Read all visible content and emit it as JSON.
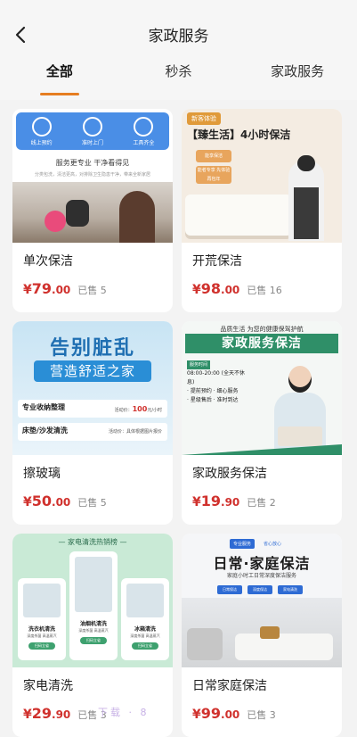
{
  "header": {
    "title": "家政服务"
  },
  "tabs": [
    {
      "label": "全部",
      "active": true
    },
    {
      "label": "秒杀",
      "active": false
    },
    {
      "label": "家政服务",
      "active": false
    }
  ],
  "colors": {
    "accent": "#e67e22",
    "price": "#d0312d"
  },
  "products": [
    {
      "title": "单次保洁",
      "price_cur": "¥",
      "price_int": "79",
      "price_dec": ".00",
      "sold": "已售 5",
      "image": {
        "icons": [
          "线上预约",
          "准时上门",
          "工具齐全"
        ],
        "slogan": "服务更专业 干净看得见",
        "small": "分类包洗，清洁更高，对排除卫生隐患干净，带来全新家居"
      }
    },
    {
      "title": "开荒保洁",
      "price_cur": "¥",
      "price_int": "98",
      "price_dec": ".00",
      "sold": "已售 16",
      "image": {
        "badge": "新客体验",
        "headline": "【臻生活】4小时保洁",
        "chip1": "能享保洁",
        "chip2": "能者专享 先体验再包年"
      }
    },
    {
      "title": "擦玻璃",
      "price_cur": "¥",
      "price_int": "50",
      "price_dec": ".00",
      "sold": "已售 5",
      "image": {
        "line1": "告别脏乱",
        "line2": "营造舒适之家",
        "row1_label": "专业收纳整理",
        "row1_note": "2小时起服务",
        "row1_price_prefix": "活动价：",
        "row1_price": "100",
        "row1_unit": "元/小时",
        "row2_label": "床垫/沙发清洗",
        "row2_note": "活动价：具体根据图片报价"
      }
    },
    {
      "title": "家政服务保洁",
      "price_cur": "¥",
      "price_int": "19",
      "price_dec": ".90",
      "sold": "已售 2",
      "image": {
        "top": "品质生活 为您的健康保驾护航",
        "banner": "家政服务保洁",
        "tag": "服务时间",
        "hours": "08:00-20:00 (全天不休息)",
        "points": [
          "· 提前预约 · 细心服务",
          "· 星级售后 · 准时到达"
        ]
      }
    },
    {
      "title": "家电清洗",
      "price_cur": "¥",
      "price_int": "29",
      "price_dec": ".90",
      "sold": "已售 3",
      "image": {
        "head": "— 家电清洗热销榜 —",
        "cells": [
          {
            "label": "洗衣机清洗",
            "sub": "深度杀菌 高温蒸汽",
            "btn": "扫码立省"
          },
          {
            "label": "油烟机清洗",
            "sub": "深度杀菌 高温蒸汽",
            "btn": "扫码立省"
          },
          {
            "label": "冰箱清洗",
            "sub": "深度杀菌 高温蒸汽",
            "btn": "扫码立省"
          }
        ]
      }
    },
    {
      "title": "日常家庭保洁",
      "price_cur": "¥",
      "price_int": "99",
      "price_dec": ".00",
      "sold": "已售 3",
      "image": {
        "tags": [
          "专业服务",
          "省心放心"
        ],
        "head": "日常·家庭保洁",
        "sub": "家庭小时工日常深度保洁服务",
        "pills": [
          "日常保洁",
          "深度保洁",
          "家电清洗"
        ]
      }
    }
  ],
  "watermark": "下载 · 8"
}
